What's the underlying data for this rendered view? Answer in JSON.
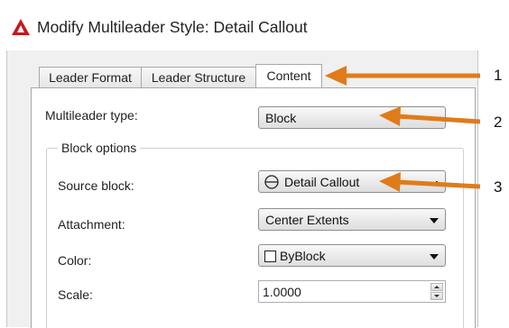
{
  "window": {
    "title": "Modify Multileader Style: Detail Callout"
  },
  "tabs": [
    {
      "label": "Leader Format",
      "active": false
    },
    {
      "label": "Leader Structure",
      "active": false
    },
    {
      "label": "Content",
      "active": true
    }
  ],
  "content": {
    "multileader_type_label": "Multileader type:",
    "multileader_type_value": "Block",
    "block_options_label": "Block options",
    "source_block_label": "Source block:",
    "source_block_value": "Detail Callout",
    "attachment_label": "Attachment:",
    "attachment_value": "Center Extents",
    "color_label": "Color:",
    "color_value": "ByBlock",
    "scale_label": "Scale:",
    "scale_value": "1.0000"
  },
  "callouts": [
    "1",
    "2",
    "3"
  ],
  "colors": {
    "arrow": "#e07b1a",
    "app_icon": "#c8161d"
  },
  "icons": {
    "app": "autocad-app-icon",
    "source_block": "circle-line-block-icon",
    "color": "color-swatch-icon"
  }
}
